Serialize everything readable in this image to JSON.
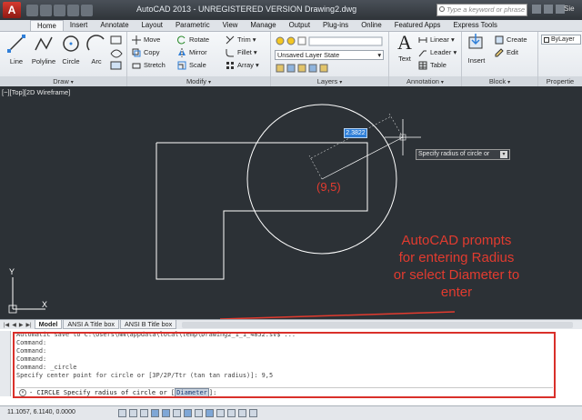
{
  "app": {
    "title": "AutoCAD 2013 - UNREGISTERED VERSION   Drawing2.dwg",
    "app_button": "A",
    "search_placeholder": "Type a keyword or phrase",
    "user": "Sie"
  },
  "ribbon_tabs": [
    "Home",
    "Insert",
    "Annotate",
    "Layout",
    "Parametric",
    "View",
    "Manage",
    "Output",
    "Plug-ins",
    "Online",
    "Featured Apps",
    "Express Tools"
  ],
  "active_tab": "Home",
  "panels": {
    "draw": {
      "title": "Draw",
      "tools": [
        "Line",
        "Polyline",
        "Circle",
        "Arc"
      ]
    },
    "modify": {
      "title": "Modify",
      "tools": [
        "Move",
        "Rotate",
        "Trim",
        "Copy",
        "Mirror",
        "Fillet",
        "Stretch",
        "Scale",
        "Array"
      ]
    },
    "layers": {
      "title": "Layers",
      "layer_state": "Unsaved Layer State"
    },
    "annotation": {
      "title": "Annotation",
      "text_tool": "Text",
      "tools": [
        "Linear",
        "Leader",
        "Table"
      ]
    },
    "block": {
      "title": "Block",
      "insert_tool": "Insert",
      "tools": [
        "Create",
        "Edit"
      ]
    },
    "properties": {
      "title": "Propertie",
      "bylayer": "ByLayer"
    }
  },
  "viewport": {
    "label": "[−][Top][2D Wireframe]",
    "dynamic_input_value": "2.3822",
    "tooltip": "Specify radius of circle or",
    "tooltip_dropdown": "▾",
    "center_label": "(9,5)",
    "annotation_lines": [
      "AutoCAD prompts",
      "for entering Radius",
      "or select Diameter to",
      "enter"
    ],
    "ucs_y": "Y",
    "ucs_x": "X"
  },
  "layout_tabs": [
    "Model",
    "ANSI A Title box",
    "ANSI B Title box"
  ],
  "active_layout": "Model",
  "command": {
    "history": [
      "Automatic save to C:\\Users\\NN\\appdata\\local\\temp\\Drawing2_1_1_4852.sv$ ...",
      "Command:",
      "Command:",
      "Command:",
      "Command: _circle",
      "Specify center point for circle or [3P/2P/Ttr (tan tan radius)]: 9,5"
    ],
    "prompt_prefix": "- CIRCLE Specify radius of circle or [",
    "keyword": "Diameter",
    "prompt_suffix": "]:",
    "close_glyph": "×"
  },
  "status": {
    "coordinates": "11.1057, 6.1140, 0.0000"
  },
  "colors": {
    "annotation_red": "#e23b2f",
    "canvas_bg": "#2c3136",
    "drawing_lines": "#ffffff",
    "highlight_blue": "#2f7fd8"
  }
}
